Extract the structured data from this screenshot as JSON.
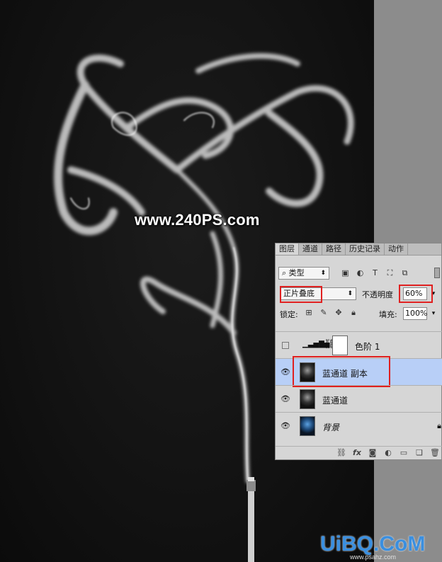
{
  "watermark": "www.240PS.com",
  "bottom_logo": "UiBQ.CoM",
  "bottom_sub": "www.psahz.com",
  "layers_panel": {
    "tabs": [
      "图层",
      "通道",
      "路径",
      "历史记录",
      "动作"
    ],
    "active_tab": "图层",
    "filter_label": "类型",
    "filter_icons": [
      "image-filter-icon",
      "adjustment-filter-icon",
      "text-filter-icon",
      "shape-filter-icon",
      "smart-object-filter-icon"
    ],
    "blend_mode": "正片叠底",
    "opacity_label": "不透明度",
    "opacity_value": "60%",
    "lock_label": "锁定",
    "fill_label": "填充",
    "fill_value": "100%",
    "layers": [
      {
        "name": "色阶 1",
        "visible": false,
        "type": "adjustment"
      },
      {
        "name": "蓝通道 副本",
        "visible": true,
        "selected": true
      },
      {
        "name": "蓝通道",
        "visible": true
      },
      {
        "name": "背景",
        "visible": true,
        "locked": true
      }
    ],
    "highlight_color": "#b8cff7",
    "red_highlight_color": "#e02020"
  }
}
